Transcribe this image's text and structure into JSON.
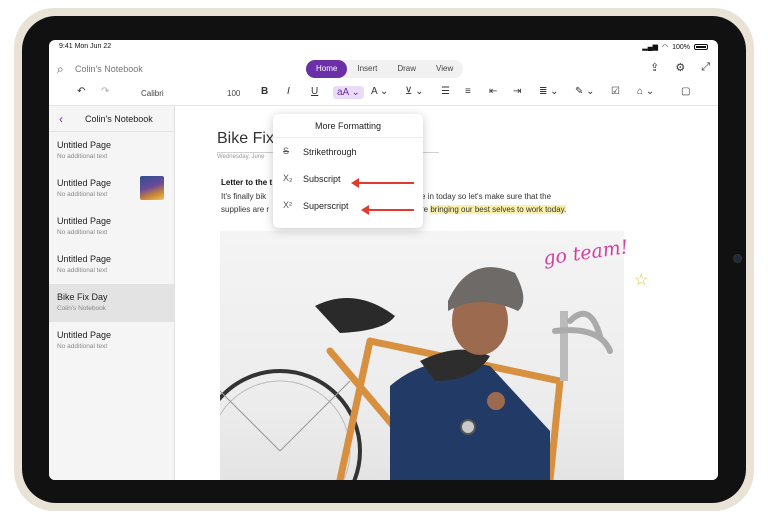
{
  "status": {
    "time": "9:41",
    "date": "Mon Jun 22",
    "battery": "100%"
  },
  "titlebar": {
    "notebook": "Colin's Notebook"
  },
  "tabs": [
    {
      "label": "Home",
      "active": true
    },
    {
      "label": "Insert",
      "active": false
    },
    {
      "label": "Draw",
      "active": false
    },
    {
      "label": "View",
      "active": false
    }
  ],
  "toolbar": {
    "font": "Calibri",
    "size": "100"
  },
  "sidebar": {
    "title": "Colin's Notebook",
    "pages": [
      {
        "title": "Untitled Page",
        "sub": "No additional text"
      },
      {
        "title": "Untitled Page",
        "sub": "No additional text"
      },
      {
        "title": "Untitled Page",
        "sub": "No additional text"
      },
      {
        "title": "Untitled Page",
        "sub": "No additional text"
      },
      {
        "title": "Bike Fix Day",
        "sub": "Colin's Notebook",
        "active": true
      },
      {
        "title": "Untitled Page",
        "sub": "No additional text"
      }
    ]
  },
  "content": {
    "title": "Bike Fix",
    "date": "Wednesday, June",
    "letter": "Letter to the t",
    "line1": "It's finally bik",
    "line1_end": "to come in today so let's make sure that the",
    "line2": "supplies are r",
    "line2_end_plain": "re ",
    "line2_highlight": "bringing our best selves to work today.",
    "handwriting": "go team!"
  },
  "menu": {
    "title": "More Formatting",
    "items": [
      {
        "label": "Strikethrough",
        "icon": "S"
      },
      {
        "label": "Subscript",
        "icon": "X₂"
      },
      {
        "label": "Superscript",
        "icon": "X²"
      }
    ]
  },
  "colors": {
    "accent": "#6b2fa8",
    "arrow": "#e23a2e",
    "highlight": "#fbf0a7",
    "handwriting": "#d23fa3"
  }
}
